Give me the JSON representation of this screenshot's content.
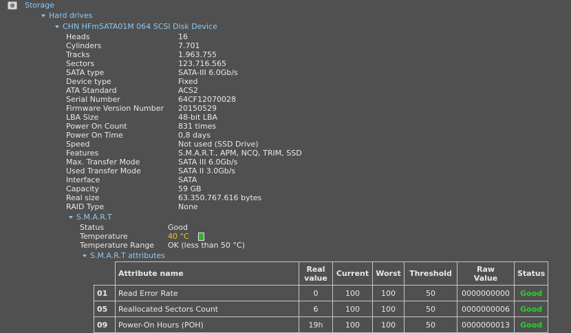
{
  "tree": {
    "storage_label": "Storage",
    "hard_drives_label": "Hard drives",
    "device_label": "CHN HFmSATA01M 064 SCSI Disk Device",
    "smart_label": "S.M.A.R.T",
    "smart_attributes_label": "S.M.A.R.T attributes"
  },
  "properties": [
    {
      "label": "Heads",
      "value": "16"
    },
    {
      "label": "Cylinders",
      "value": "7.701"
    },
    {
      "label": "Tracks",
      "value": "1.963.755"
    },
    {
      "label": "Sectors",
      "value": "123.716.565"
    },
    {
      "label": "SATA type",
      "value": "SATA-III 6.0Gb/s"
    },
    {
      "label": "Device type",
      "value": "Fixed"
    },
    {
      "label": "ATA Standard",
      "value": "ACS2"
    },
    {
      "label": "Serial Number",
      "value": "64CF12070028"
    },
    {
      "label": "Firmware Version Number",
      "value": "20150529"
    },
    {
      "label": "LBA Size",
      "value": "48-bit LBA"
    },
    {
      "label": "Power On Count",
      "value": "831 times"
    },
    {
      "label": "Power On Time",
      "value": "0,8 days"
    },
    {
      "label": "Speed",
      "value": "Not used (SSD Drive)"
    },
    {
      "label": "Features",
      "value": "S.M.A.R.T., APM, NCQ, TRIM, SSD"
    },
    {
      "label": "Max. Transfer Mode",
      "value": "SATA III 6.0Gb/s"
    },
    {
      "label": "Used Transfer Mode",
      "value": "SATA II 3.0Gb/s"
    },
    {
      "label": "Interface",
      "value": "SATA"
    },
    {
      "label": "Capacity",
      "value": "59 GB"
    },
    {
      "label": "Real size",
      "value": "63.350.767.616 bytes"
    },
    {
      "label": "RAID Type",
      "value": "None"
    }
  ],
  "smart": [
    {
      "label": "Status",
      "value": "Good"
    },
    {
      "label": "Temperature",
      "value": "40 °C"
    },
    {
      "label": "Temperature Range",
      "value": "OK (less than 50 °C)"
    }
  ],
  "colors": {
    "temperature_indicator": "#2fb02f",
    "good_status": "#2fcc2f",
    "temperature_text": "#f0c040"
  },
  "smart_table": {
    "headers": {
      "name": "Attribute name",
      "real_line1": "Real",
      "real_line2": "value",
      "current": "Current",
      "worst": "Worst",
      "threshold": "Threshold",
      "raw_line1": "Raw",
      "raw_line2": "Value",
      "status": "Status"
    },
    "rows": [
      {
        "id": "01",
        "name": "Read Error Rate",
        "real": "0",
        "current": "100",
        "worst": "100",
        "threshold": "50",
        "raw": "0000000000",
        "status": "Good"
      },
      {
        "id": "05",
        "name": "Reallocated Sectors Count",
        "real": "6",
        "current": "100",
        "worst": "100",
        "threshold": "50",
        "raw": "0000000006",
        "status": "Good"
      },
      {
        "id": "09",
        "name": "Power-On Hours (POH)",
        "real": "19h",
        "current": "100",
        "worst": "100",
        "threshold": "50",
        "raw": "0000000013",
        "status": "Good"
      }
    ]
  }
}
